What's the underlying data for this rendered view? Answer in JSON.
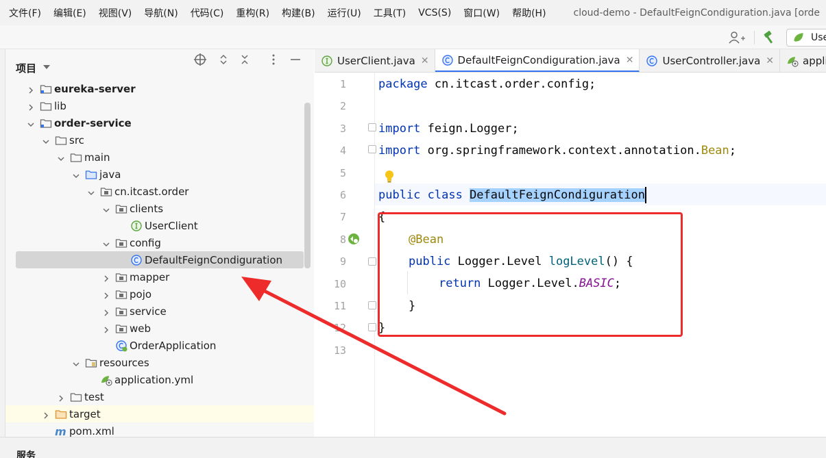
{
  "menu": [
    "文件(F)",
    "编辑(E)",
    "视图(V)",
    "导航(N)",
    "代码(C)",
    "重构(R)",
    "构建(B)",
    "运行(U)",
    "工具(T)",
    "VCS(S)",
    "窗口(W)",
    "帮助(H)"
  ],
  "window_title": "cloud-demo - DefaultFeignCondiguration.java [orde",
  "toolbar": {
    "run_config_label": "Use"
  },
  "project_panel": {
    "title": "项目",
    "tree": [
      {
        "label": "eureka-server",
        "depth": 0,
        "icon": "module-folder-icon",
        "arrow": "right",
        "bold": true
      },
      {
        "label": "lib",
        "depth": 0,
        "icon": "folder-icon",
        "arrow": "right"
      },
      {
        "label": "order-service",
        "depth": 0,
        "icon": "module-folder-icon",
        "arrow": "down",
        "bold": true
      },
      {
        "label": "src",
        "depth": 1,
        "icon": "folder-icon",
        "arrow": "down"
      },
      {
        "label": "main",
        "depth": 2,
        "icon": "folder-icon",
        "arrow": "down"
      },
      {
        "label": "java",
        "depth": 3,
        "icon": "source-folder-icon",
        "arrow": "down"
      },
      {
        "label": "cn.itcast.order",
        "depth": 4,
        "icon": "package-icon",
        "arrow": "down"
      },
      {
        "label": "clients",
        "depth": 5,
        "icon": "package-icon",
        "arrow": "down"
      },
      {
        "label": "UserClient",
        "depth": 6,
        "icon": "interface-icon",
        "arrow": "none"
      },
      {
        "label": "config",
        "depth": 5,
        "icon": "package-icon",
        "arrow": "down"
      },
      {
        "label": "DefaultFeignCondiguration",
        "depth": 6,
        "icon": "class-icon",
        "arrow": "none",
        "selected": true
      },
      {
        "label": "mapper",
        "depth": 5,
        "icon": "package-icon",
        "arrow": "right"
      },
      {
        "label": "pojo",
        "depth": 5,
        "icon": "package-icon",
        "arrow": "right"
      },
      {
        "label": "service",
        "depth": 5,
        "icon": "package-icon",
        "arrow": "right"
      },
      {
        "label": "web",
        "depth": 5,
        "icon": "package-icon",
        "arrow": "right"
      },
      {
        "label": "OrderApplication",
        "depth": 5,
        "icon": "spring-app-class-icon",
        "arrow": "none"
      },
      {
        "label": "resources",
        "depth": 3,
        "icon": "resources-folder-icon",
        "arrow": "down"
      },
      {
        "label": "application.yml",
        "depth": 4,
        "icon": "spring-yml-icon",
        "arrow": "none"
      },
      {
        "label": "test",
        "depth": 2,
        "icon": "folder-icon",
        "arrow": "right"
      },
      {
        "label": "target",
        "depth": 1,
        "icon": "target-folder-icon",
        "arrow": "right",
        "highlight": true
      },
      {
        "label": "pom.xml",
        "depth": 1,
        "icon": "maven-icon",
        "arrow": "none"
      }
    ]
  },
  "tabs": [
    {
      "label": "UserClient.java",
      "icon": "interface-icon",
      "active": false
    },
    {
      "label": "DefaultFeignCondiguration.java",
      "icon": "class-icon",
      "active": true
    },
    {
      "label": "UserController.java",
      "icon": "class-icon",
      "active": false
    },
    {
      "label": "applicat",
      "icon": "spring-yml-icon",
      "active": false
    }
  ],
  "editor": {
    "line_numbers": [
      "1",
      "2",
      "3",
      "4",
      "5",
      "6",
      "7",
      "8",
      "9",
      "10",
      "11",
      "12",
      "13"
    ],
    "code": {
      "l1_kw": "package",
      "l1_rest": " cn.itcast.order.config;",
      "l3_kw": "import",
      "l3_rest": " feign.Logger;",
      "l4_kw": "import",
      "l4_rest": " org.springframework.context.annotation.",
      "l4_ann": "Bean",
      "l4_end": ";",
      "l6_kw": "public class ",
      "l6_name": "DefaultFeignCondiguration",
      "l7": "{",
      "l8_ann": "@Bean",
      "l9_kw": "public",
      "l9_type": " Logger.Level ",
      "l9_fn": "logLevel",
      "l9_end": "() {",
      "l10_kw": "return",
      "l10_rest": " Logger.Level.",
      "l10_const": "BASIC",
      "l10_end": ";",
      "l11": "}",
      "l12": "}"
    }
  },
  "bottom": {
    "label": "服务"
  },
  "colors": {
    "annotation_red": "#ee2b2b",
    "selection": "#a6d2ff",
    "keyword": "#0033b3"
  }
}
